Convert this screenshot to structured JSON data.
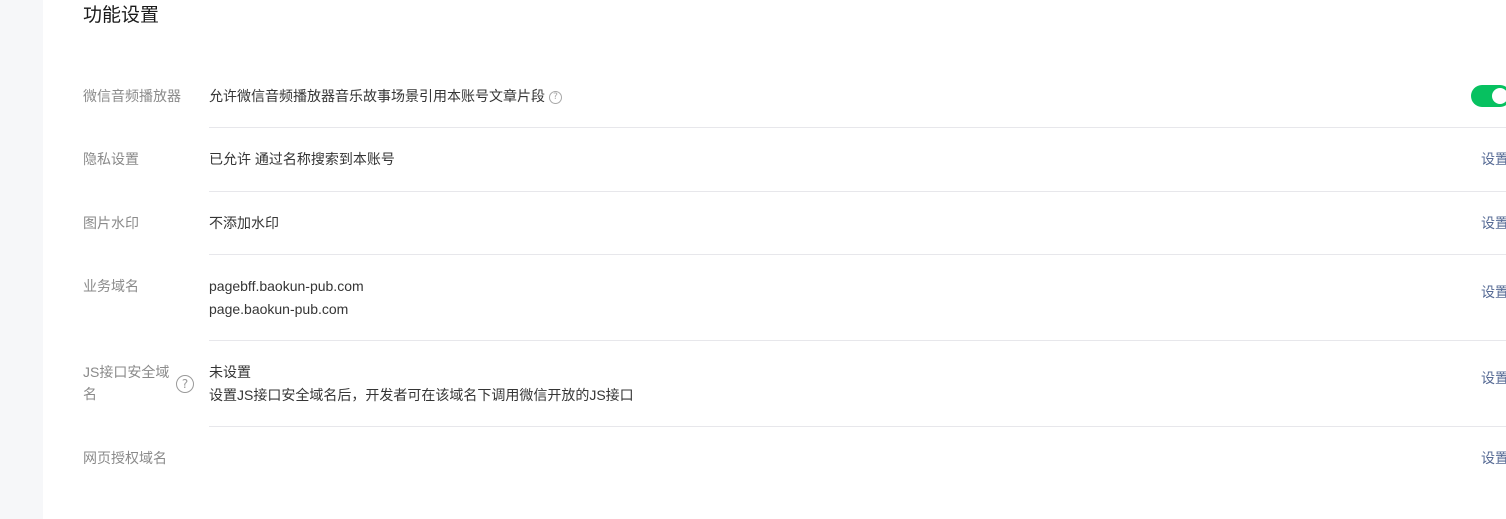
{
  "page": {
    "title": "功能设置"
  },
  "rows": [
    {
      "label": "微信音频播放器",
      "content": "允许微信音频播放器音乐故事场景引用本账号文章片段",
      "help_glyph": "?",
      "toggle_on": true
    },
    {
      "label": "隐私设置",
      "content": "已允许 通过名称搜索到本账号",
      "action": "设置"
    },
    {
      "label": "图片水印",
      "content": "不添加水印",
      "action": "设置"
    },
    {
      "label": "业务域名",
      "content_lines": [
        "pagebff.baokun-pub.com",
        "page.baokun-pub.com"
      ],
      "action": "设置"
    },
    {
      "label": "JS接口安全域名",
      "label_line1": "JS接口安全域",
      "label_line2": "名",
      "help_glyph": "?",
      "content_lines": [
        "未设置",
        "设置JS接口安全域名后，开发者可在该域名下调用微信开放的JS接口"
      ],
      "action": "设置"
    },
    {
      "label": "网页授权域名",
      "content": "",
      "action": "设置"
    }
  ],
  "colors": {
    "accent_green": "#07c160",
    "link": "#576b95",
    "label_gray": "#8a8a8a",
    "divider": "#e7e7eb",
    "rail": "#f6f7f9"
  },
  "icons": {
    "help": "question-circle-icon"
  }
}
